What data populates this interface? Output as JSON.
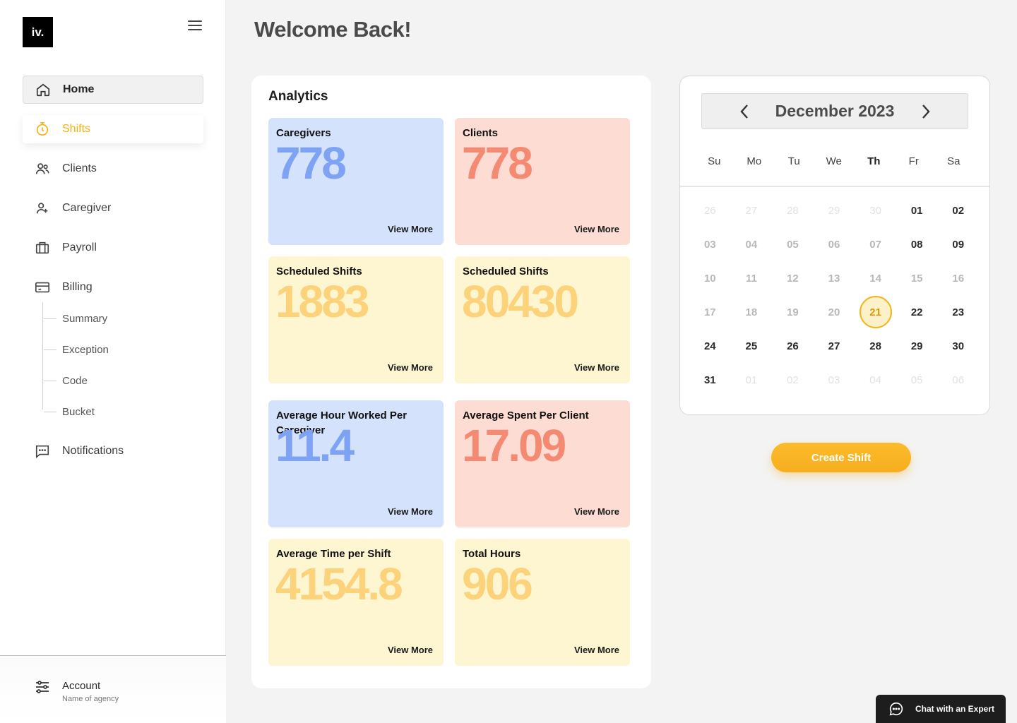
{
  "logo": "iv.",
  "page_title": "Welcome Back!",
  "nav": {
    "home": "Home",
    "shifts": "Shifts",
    "clients": "Clients",
    "caregiver": "Caregiver",
    "payroll": "Payroll",
    "billing": "Billing",
    "billing_sub": [
      "Summary",
      "Exception",
      "Code",
      "Bucket"
    ],
    "notifications": "Notifications"
  },
  "account": {
    "title": "Account",
    "subtitle": "Name of agency"
  },
  "analytics": {
    "title": "Analytics",
    "view_more": "View More",
    "cards": [
      {
        "title": "Caregivers",
        "value": "778",
        "color": "blue"
      },
      {
        "title": "Clients",
        "value": "778",
        "color": "pink"
      },
      {
        "title": "Scheduled Shifts",
        "value": "1883",
        "color": "yellow"
      },
      {
        "title": "Scheduled Shifts",
        "value": "80430",
        "color": "yellow"
      },
      {
        "title": "Average Hour Worked Per Caregiver",
        "value": "11.4",
        "color": "blue"
      },
      {
        "title": "Average Spent Per Client",
        "value": "17.09",
        "color": "pink"
      },
      {
        "title": "Average Time per Shift",
        "value": "4154.8",
        "color": "yellow"
      },
      {
        "title": "Total Hours",
        "value": "906",
        "color": "yellow"
      }
    ]
  },
  "calendar": {
    "month": "December 2023",
    "weekdays": [
      "Su",
      "Mo",
      "Tu",
      "We",
      "Th",
      "Fr",
      "Sa"
    ],
    "selected_weekday": "Th",
    "today": "21",
    "weeks": [
      [
        "26",
        "27",
        "28",
        "29",
        "30",
        "01",
        "02"
      ],
      [
        "03",
        "04",
        "05",
        "06",
        "07",
        "08",
        "09"
      ],
      [
        "10",
        "11",
        "12",
        "13",
        "14",
        "15",
        "16"
      ],
      [
        "17",
        "18",
        "19",
        "20",
        "21",
        "22",
        "23"
      ],
      [
        "24",
        "25",
        "26",
        "27",
        "28",
        "29",
        "30"
      ],
      [
        "31",
        "01",
        "02",
        "03",
        "04",
        "05",
        "06"
      ]
    ]
  },
  "create_shift": "Create Shift",
  "chat": "Chat with an Expert",
  "colors": {
    "accent": "#f7ae1f",
    "blue": "#d5e2fc",
    "pink": "#fddcd3",
    "yellow": "#fef5d1"
  }
}
